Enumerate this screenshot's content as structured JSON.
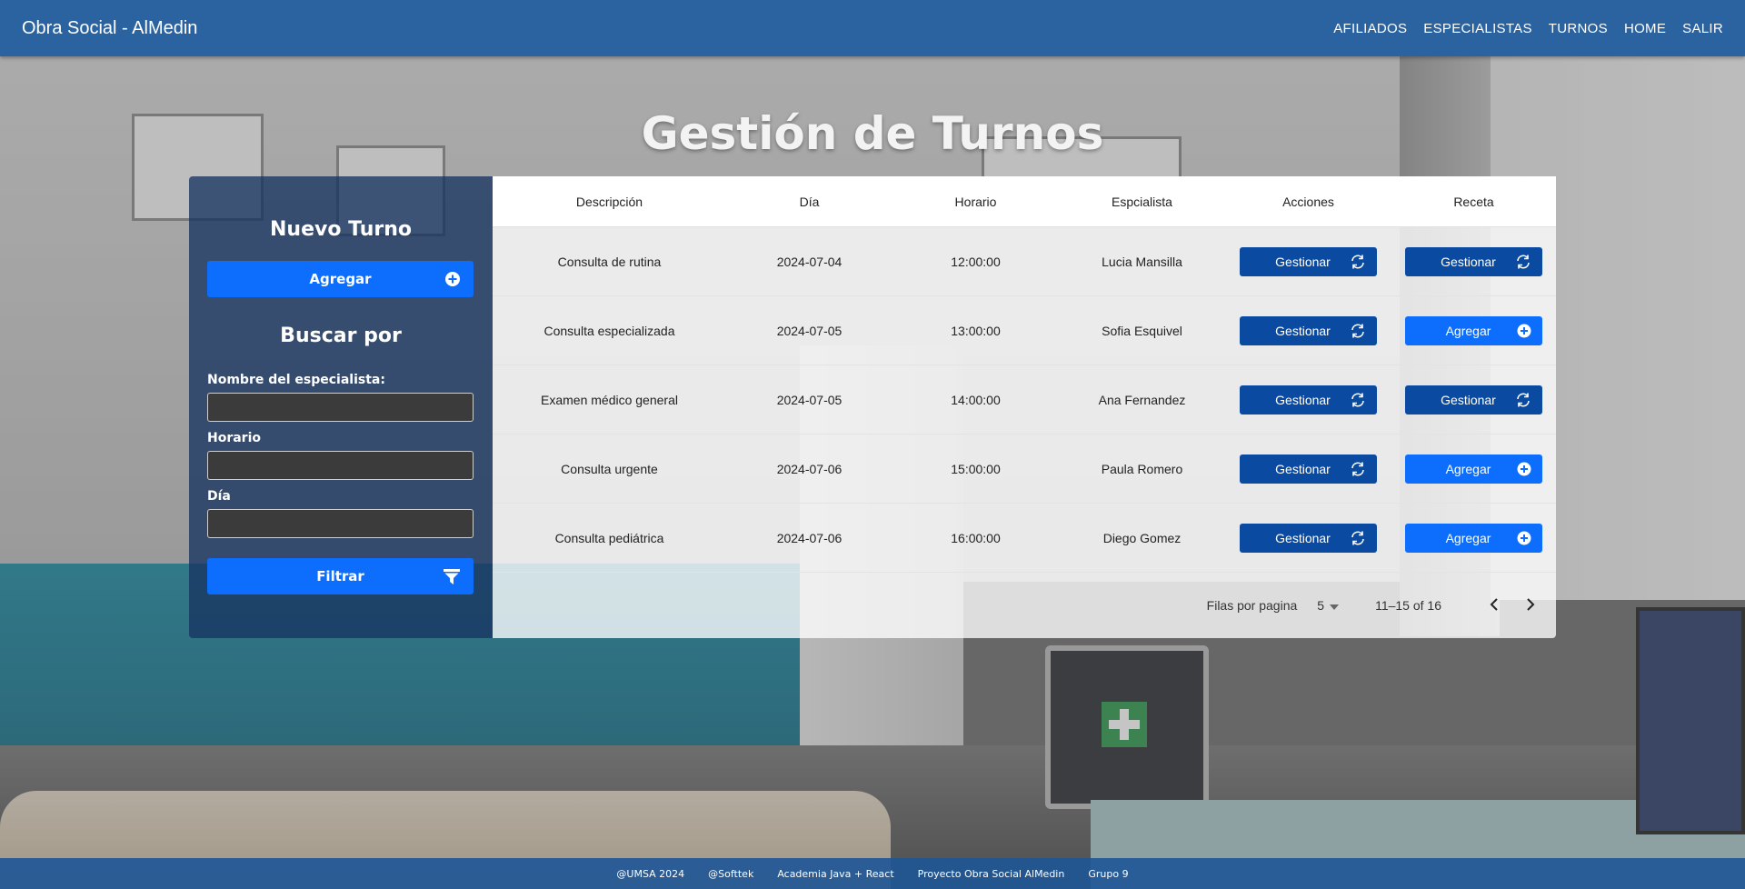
{
  "navbar": {
    "brand": "Obra Social - AlMedin",
    "links": [
      "AFILIADOS",
      "ESPECIALISTAS",
      "TURNOS",
      "HOME",
      "SALIR"
    ]
  },
  "page_title": "Gestión de Turnos",
  "side_panel": {
    "new_heading": "Nuevo Turno",
    "add_label": "Agregar",
    "search_heading": "Buscar por",
    "specialist_label": "Nombre del especialista:",
    "specialist_value": "",
    "time_label": "Horario",
    "time_value": "",
    "day_label": "Día",
    "day_value": "",
    "filter_label": "Filtrar"
  },
  "table": {
    "headers": [
      "Descripción",
      "Día",
      "Horario",
      "Espcialista",
      "Acciones",
      "Receta"
    ],
    "rows": [
      {
        "descripcion": "Consulta de rutina",
        "dia": "2024-07-04",
        "horario": "12:00:00",
        "especialista": "Lucia Mansilla",
        "accion": "Gestionar",
        "receta": "Gestionar",
        "receta_type": "manage"
      },
      {
        "descripcion": "Consulta especializada",
        "dia": "2024-07-05",
        "horario": "13:00:00",
        "especialista": "Sofia Esquivel",
        "accion": "Gestionar",
        "receta": "Agregar",
        "receta_type": "add"
      },
      {
        "descripcion": "Examen médico general",
        "dia": "2024-07-05",
        "horario": "14:00:00",
        "especialista": "Ana Fernandez",
        "accion": "Gestionar",
        "receta": "Gestionar",
        "receta_type": "manage"
      },
      {
        "descripcion": "Consulta urgente",
        "dia": "2024-07-06",
        "horario": "15:00:00",
        "especialista": "Paula Romero",
        "accion": "Gestionar",
        "receta": "Agregar",
        "receta_type": "add"
      },
      {
        "descripcion": "Consulta pediátrica",
        "dia": "2024-07-06",
        "horario": "16:00:00",
        "especialista": "Diego Gomez",
        "accion": "Gestionar",
        "receta": "Agregar",
        "receta_type": "add"
      }
    ]
  },
  "pagination": {
    "rows_label": "Filas por pagina",
    "rows_value": "5",
    "range": "11–15 of 16"
  },
  "footer": [
    "@UMSA 2024",
    "@Softtek",
    "Academia Java + React",
    "Proyecto Obra Social AlMedin",
    "Grupo 9"
  ],
  "colors": {
    "navbar": "#2b63a0",
    "primary_button": "#0d6efd",
    "dark_button": "#0a4aa0",
    "panel": "#183462"
  },
  "icons": {
    "add": "plus-circle-icon",
    "manage": "refresh-icon",
    "filter": "filter-icon",
    "prev": "chevron-left-icon",
    "next": "chevron-right-icon",
    "dropdown": "caret-down-icon"
  }
}
